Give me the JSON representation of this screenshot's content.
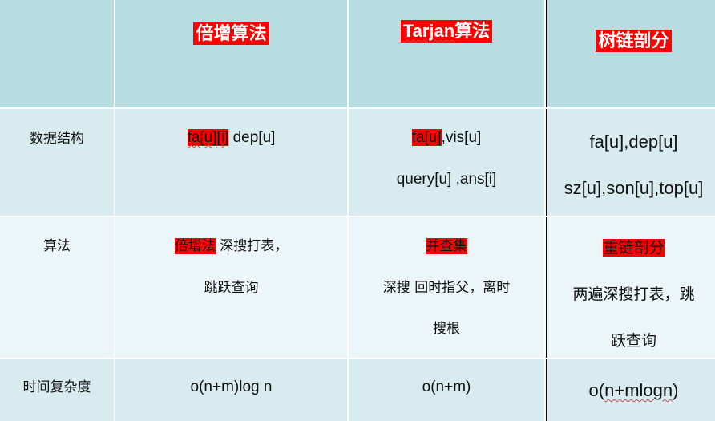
{
  "headers": {
    "blank": "",
    "col2": "倍增算法",
    "col3": "Tarjan算法",
    "col4": "树链剖分"
  },
  "rows": [
    {
      "label": "数据结构",
      "col2": {
        "hl": "fa[u][i]",
        "rest": " dep[u]"
      },
      "col3": {
        "hl": "fa[u]",
        "rest": ",vis[u]",
        "line2": "query[u] ,ans[i]"
      },
      "col4": {
        "line1": "fa[u],dep[u]",
        "line2": "sz[u],son[u],top[u]"
      }
    },
    {
      "label": "算法",
      "col2": {
        "hl": "倍增法",
        "rest": " 深搜打表，",
        "line2": "跳跃查询"
      },
      "col3": {
        "hl": "并查集",
        "line2": "深搜  回时指父，离时",
        "line3": "搜根"
      },
      "col4": {
        "hl": "重链剖分",
        "line2": "两遍深搜打表，跳",
        "line3": "跃查询"
      }
    },
    {
      "label": "时间复杂度",
      "col2": "o(n+m)log n",
      "col3": "o(n+m)",
      "col4": {
        "pre": "o(",
        "wavy": "n+mlogn",
        "post": ")"
      }
    }
  ],
  "colors": {
    "header_bg": "#b7dce2",
    "band1_bg": "#d8ebef",
    "band2_bg": "#ecf5f7",
    "highlight": "#ff0000"
  }
}
